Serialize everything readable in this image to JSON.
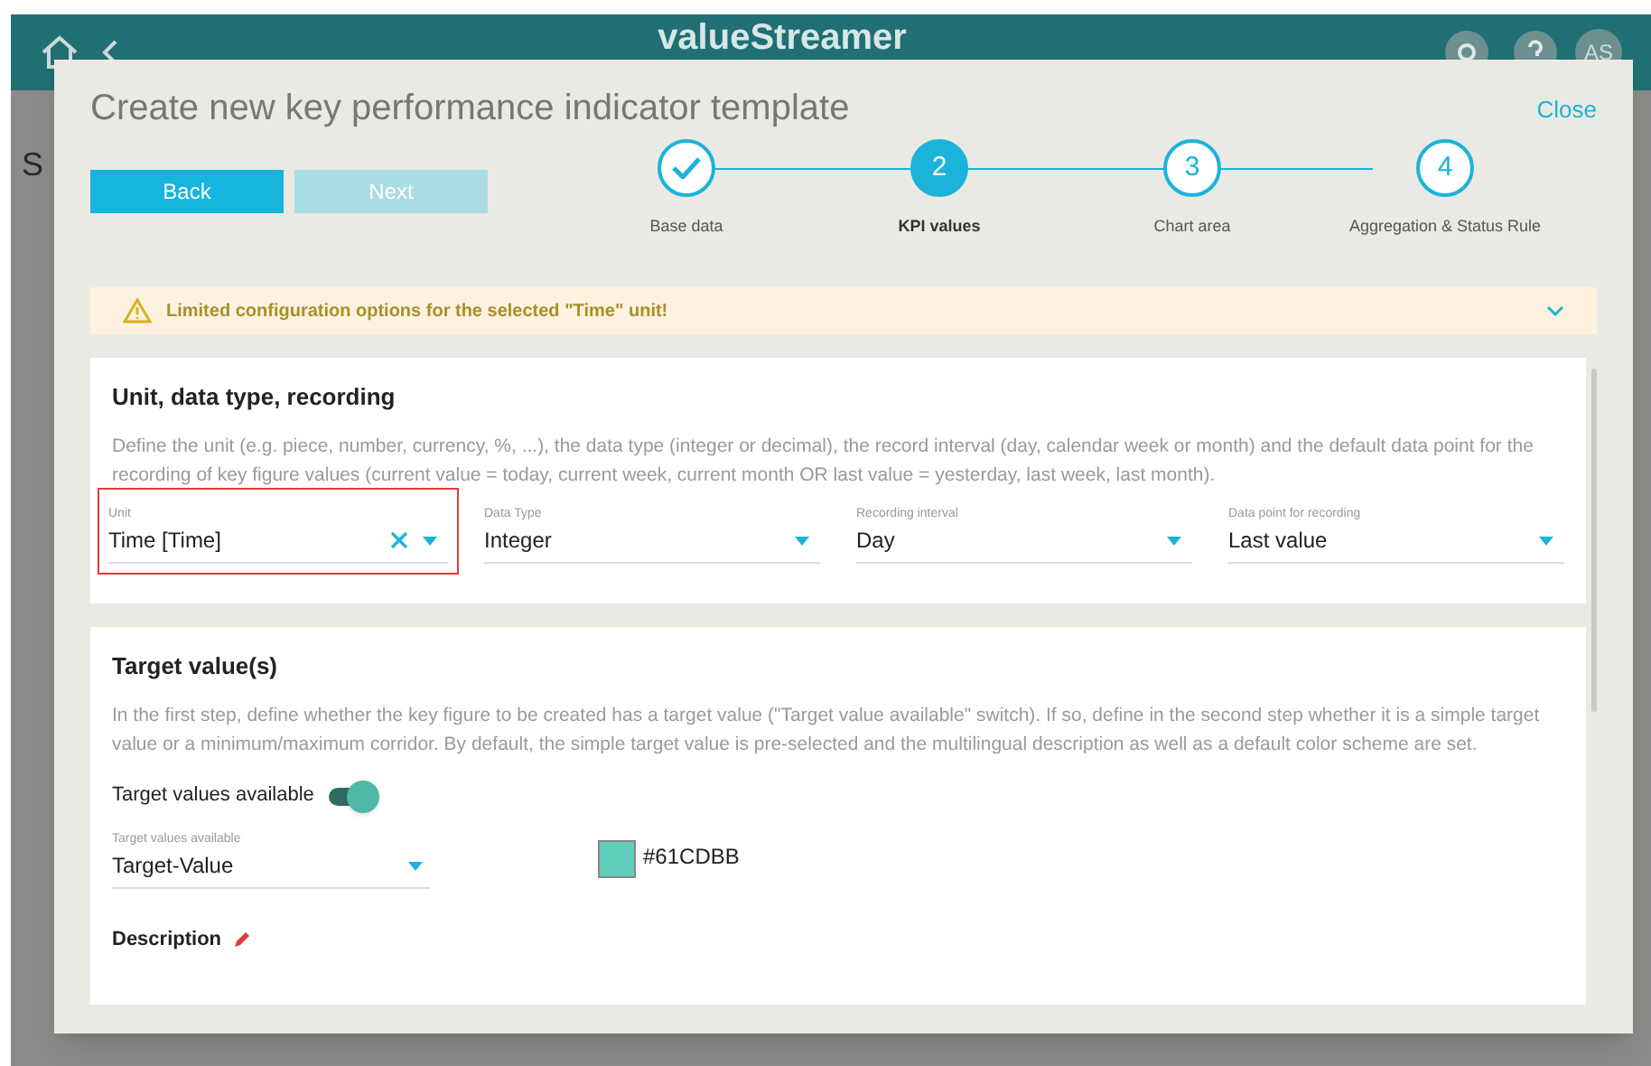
{
  "app_header": {
    "logo": "valueStreamer",
    "avatar": "AS"
  },
  "background_heading": "S",
  "dialog": {
    "title": "Create new key performance indicator template",
    "close": "Close",
    "buttons": [
      {
        "label": "Back",
        "disabled": false
      },
      {
        "label": "Next",
        "disabled": true
      }
    ],
    "steps": [
      {
        "label": "Base data",
        "completed": true,
        "selected": false
      },
      {
        "number": "2",
        "label": "KPI values",
        "completed": false,
        "selected": true
      },
      {
        "number": "3",
        "label": "Chart area",
        "completed": false,
        "selected": false
      },
      {
        "number": "4",
        "label": "Aggregation & Status Rule",
        "completed": false,
        "selected": false
      }
    ],
    "warning": {
      "text": "Limited configuration options for the selected \"Time\" unit!",
      "expanded": false
    },
    "unit_section": {
      "title": "Unit, data type, recording",
      "description": "Define the unit (e.g. piece, number, currency, %, ...), the data type (integer or decimal), the record interval (day, calendar week or month) and the default data point for the recording of key figure values (current value = today, current week, current month OR last value = yesterday, last week, last month).",
      "fields": [
        {
          "label": "Unit",
          "value": "Time [Time]",
          "clearable": true,
          "highlighted": true
        },
        {
          "label": "Data Type",
          "value": "Integer",
          "clearable": false,
          "highlighted": false
        },
        {
          "label": "Recording interval",
          "value": "Day",
          "clearable": false,
          "highlighted": false
        },
        {
          "label": "Data point for recording",
          "value": "Last value",
          "clearable": false,
          "highlighted": false
        }
      ]
    },
    "target_section": {
      "title": "Target value(s)",
      "description": "In the first step, define whether the key figure to be created has a target value (\"Target value available\" switch). If so, define in the second step whether it is a simple target value or a minimum/maximum corridor. By default, the simple target value is pre-selected and the multilingual description as well as a default color scheme are set.",
      "toggle": {
        "label": "Target values available",
        "on": true
      },
      "select": {
        "label": "Target values available",
        "value": "Target-Value"
      },
      "swatch": {
        "color": "#61cdbb",
        "text": "#61CDBB"
      },
      "description_label": "Description"
    }
  }
}
